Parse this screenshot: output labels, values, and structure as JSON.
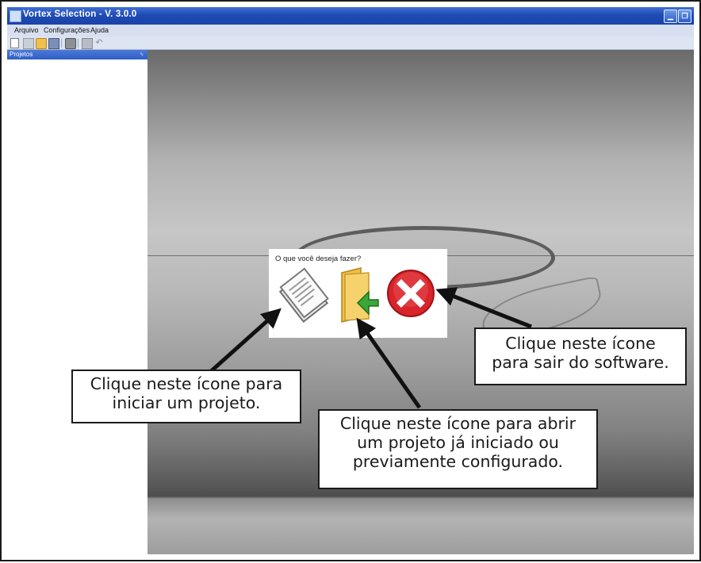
{
  "window": {
    "title": "Vortex Selection - V. 3.0.0",
    "minimize": "▁",
    "maximize": "❐"
  },
  "menu": {
    "items": [
      "Arquivo",
      "Configurações",
      "Ajuda"
    ]
  },
  "toolbar": {
    "icons": [
      "new-document-icon",
      "grid-icon",
      "open-folder-icon",
      "save-disk-icon",
      "print-icon",
      "calculator-icon",
      "exit-icon"
    ]
  },
  "projects_panel": {
    "title": "Projetos",
    "pin": "ᛃ"
  },
  "dialog": {
    "question": "O que você deseja fazer?",
    "options": [
      {
        "icon": "new-project-document-icon"
      },
      {
        "icon": "open-project-folder-icon"
      },
      {
        "icon": "exit-red-x-icon"
      }
    ]
  },
  "callouts": {
    "new_project": [
      "Clique neste ícone para",
      "iniciar um projeto."
    ],
    "open_project": [
      "Clique neste ícone para abrir",
      "um projeto já iniciado ou",
      "previamente configurado."
    ],
    "exit_software": [
      "Clique neste ícone",
      "para sair do software."
    ]
  },
  "colors": {
    "titlebar": "#1e4bb4",
    "arrow": "#111111",
    "exit_red": "#d8242a",
    "folder_yellow": "#f3c94b",
    "folder_arrow_green": "#3aa63a"
  }
}
